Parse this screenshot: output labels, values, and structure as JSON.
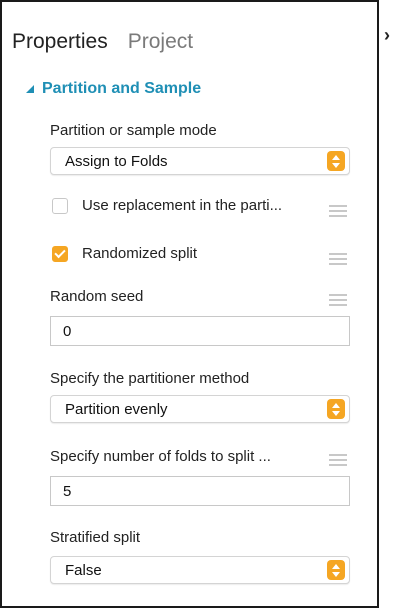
{
  "tabs": {
    "active": "Properties",
    "inactive": "Project"
  },
  "collapse_glyph": "›",
  "section": {
    "title": "Partition and Sample"
  },
  "fields": {
    "mode": {
      "label": "Partition or sample mode",
      "value": "Assign to Folds"
    },
    "replacement": {
      "label": "Use replacement in the parti...",
      "checked": false
    },
    "randomized": {
      "label": "Randomized split",
      "checked": true
    },
    "seed": {
      "label": "Random seed",
      "value": "0"
    },
    "method": {
      "label": "Specify the partitioner method",
      "value": "Partition evenly"
    },
    "folds": {
      "label": "Specify number of folds to split ...",
      "value": "5"
    },
    "stratified": {
      "label": "Stratified split",
      "value": "False"
    }
  },
  "colors": {
    "accent": "#1f8fb5",
    "orange": "#f5a623",
    "border": "#1a1a1a"
  },
  "icons": {
    "collapse": "chevron-right-icon",
    "section_caret": "caret-down-icon",
    "stepper": "up-down-stepper-icon",
    "handle": "drag-handle-icon",
    "check": "checkmark-icon"
  }
}
